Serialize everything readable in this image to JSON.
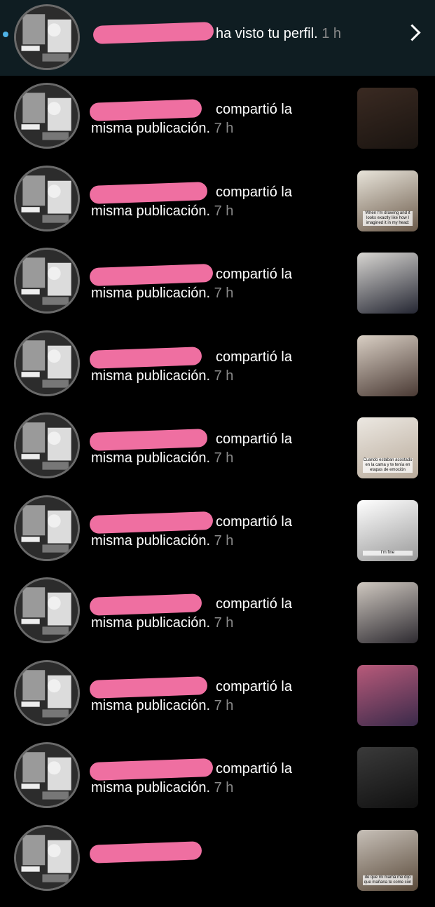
{
  "header_notification": {
    "text": "ha visto tu perfil.",
    "time": "1 h"
  },
  "notifications": [
    {
      "line1": "compartió la",
      "line2": "misma publicación.",
      "time": "7 h",
      "thumb_colors": [
        "#3a2a22",
        "#1a1410"
      ]
    },
    {
      "line1": "compartió la",
      "line2": "misma publicación.",
      "time": "7 h",
      "thumb_colors": [
        "#e8e4da",
        "#6b5a4a"
      ],
      "thumb_caption": "When I'm drawing and it looks exactly like how I imagined it in my head:"
    },
    {
      "line1": "compartió la",
      "line2": "misma publicación.",
      "time": "7 h",
      "thumb_colors": [
        "#d8d6d2",
        "#242632"
      ]
    },
    {
      "line1": "compartió la",
      "line2": "misma publicación.",
      "time": "7 h",
      "thumb_colors": [
        "#d9cfc4",
        "#4a3a34"
      ]
    },
    {
      "line1": "compartió la",
      "line2": "misma publicación.",
      "time": "7 h",
      "thumb_colors": [
        "#ece8e2",
        "#b8aa9a"
      ],
      "thumb_caption": "Cuando estaban acostado en la cama y te tenía en etapas de emoción"
    },
    {
      "line1": "compartió la",
      "line2": "misma publicación.",
      "time": "7 h",
      "thumb_colors": [
        "#ffffff",
        "#999999"
      ],
      "thumb_caption": "I'm fine"
    },
    {
      "line1": "compartió la",
      "line2": "misma publicación.",
      "time": "7 h",
      "thumb_colors": [
        "#cfc8c0",
        "#2d2a30"
      ]
    },
    {
      "line1": "compartió la",
      "line2": "misma publicación.",
      "time": "7 h",
      "thumb_colors": [
        "#b85a7a",
        "#3a2a4a"
      ]
    },
    {
      "line1": "compartió la",
      "line2": "misma publicación.",
      "time": "7 h",
      "thumb_colors": [
        "#3a3a3a",
        "#101010"
      ]
    },
    {
      "line1": "",
      "line2": "",
      "time": "",
      "thumb_colors": [
        "#c7c0b8",
        "#5a4a3a"
      ],
      "thumb_caption": "de que mi mamá me dijo que mañana te come con"
    }
  ],
  "colors": {
    "background": "#000000",
    "highlight_row": "#0f1d22",
    "unread_dot": "#4fb3e8",
    "redaction": "#ef6fa1",
    "time_text": "#8a8a8a"
  },
  "icons": {
    "avatar": "eminem-profile-avatar",
    "chevron": "chevron-right-icon"
  }
}
